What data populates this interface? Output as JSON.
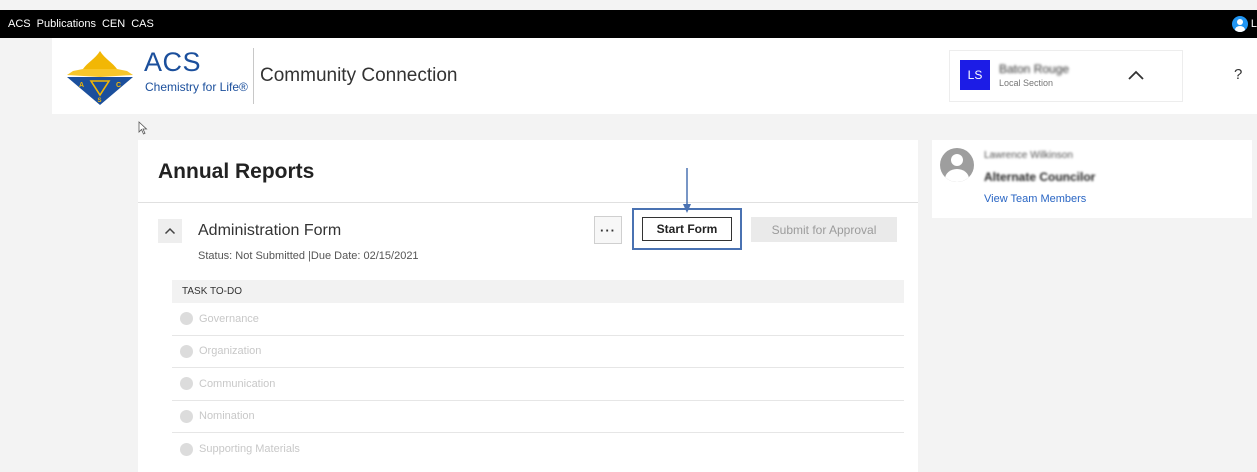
{
  "topbar": {
    "links": [
      "ACS",
      "Publications",
      "CEN",
      "CAS"
    ],
    "user_initial": "L"
  },
  "header": {
    "logo_text": "ACS",
    "logo_tagline": "Chemistry for Life®",
    "app_name": "Community Connection",
    "section": {
      "initials": "LS",
      "name": "Baton Rouge",
      "type": "Local Section"
    },
    "help_label": "?"
  },
  "main": {
    "title": "Annual Reports",
    "form": {
      "title": "Administration Form",
      "status": "Status: Not Submitted |Due Date: 02/15/2021",
      "more_label": "···",
      "start_label": "Start Form",
      "submit_label": "Submit for Approval"
    },
    "task_header": "TASK TO-DO",
    "tasks": [
      "Governance",
      "Organization",
      "Communication",
      "Nomination",
      "Supporting Materials"
    ]
  },
  "sidebar": {
    "person_name": "Lawrence Wilkinson",
    "person_role": "Alternate Councilor",
    "link_label": "View Team Members"
  },
  "colors": {
    "accent_blue": "#1c1ce6",
    "link_blue": "#2a66c4",
    "highlight_border": "#4a72b2"
  }
}
